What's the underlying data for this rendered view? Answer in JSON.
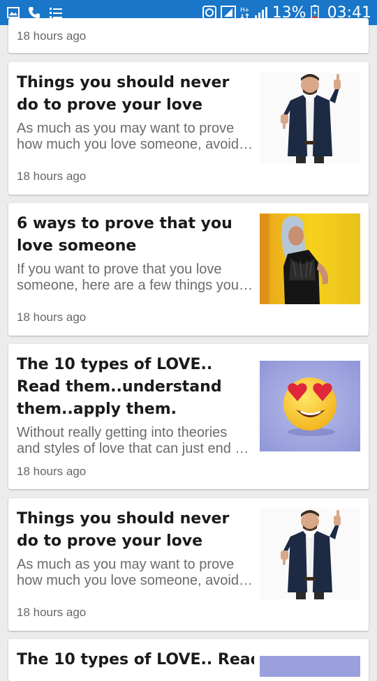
{
  "status_bar": {
    "battery": "13%",
    "time": "03:41",
    "icons": [
      "gallery-icon",
      "phone-icon",
      "list-icon",
      "sync-icon",
      "signal-box-icon",
      "network-type-icon",
      "signal-bars-icon",
      "battery-icon"
    ]
  },
  "cards": [
    {
      "title": "",
      "excerpt": "",
      "time": "18 hours ago",
      "image": ""
    },
    {
      "title": "Things you should never do to prove your love",
      "excerpt": "As much as you may want to prove how much you love someone, avoid these things you should never do",
      "time": "18 hours ago",
      "image": "man-thumbs-icon"
    },
    {
      "title": "6 ways to prove that you love someone",
      "excerpt": "If you want to prove that you love someone, here are a few things you can do to show it",
      "time": "18 hours ago",
      "image": "woman-yellow-icon"
    },
    {
      "title": "The 10 types of LOVE.. Read them..understand them..apply them.",
      "excerpt": "Without really getting into theories and styles of love that can just end up confusing you",
      "time": "18 hours ago",
      "image": "heart-eyes-emoji-icon"
    },
    {
      "title": "Things you should never do to prove your love",
      "excerpt": "As much as you may want to prove how much you love someone, avoid these things you should never do",
      "time": "18 hours ago",
      "image": "man-thumbs-icon"
    },
    {
      "title": "The 10 types of LOVE.. Read",
      "excerpt": "",
      "time": "",
      "image": "heart-eyes-emoji-icon"
    }
  ],
  "colors": {
    "status_bar": "#1976c8",
    "background": "#ececec",
    "card": "#ffffff",
    "title": "#1a1a1a",
    "excerpt": "#6b6b6b",
    "time": "#666666"
  }
}
